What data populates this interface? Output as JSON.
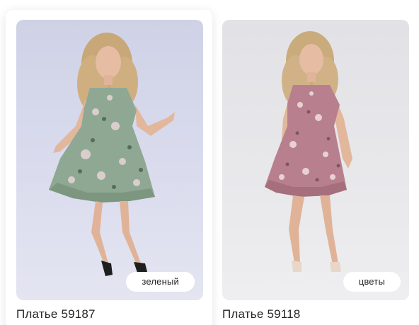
{
  "products": [
    {
      "name": "Платье 59187",
      "color_tag": "зеленый",
      "dress_color": "#8fa894",
      "background_color": "#d8daec"
    },
    {
      "name": "Платье 59118",
      "color_tag": "цветы",
      "dress_color": "#b8808e",
      "background_color": "#e6e6e9"
    }
  ]
}
